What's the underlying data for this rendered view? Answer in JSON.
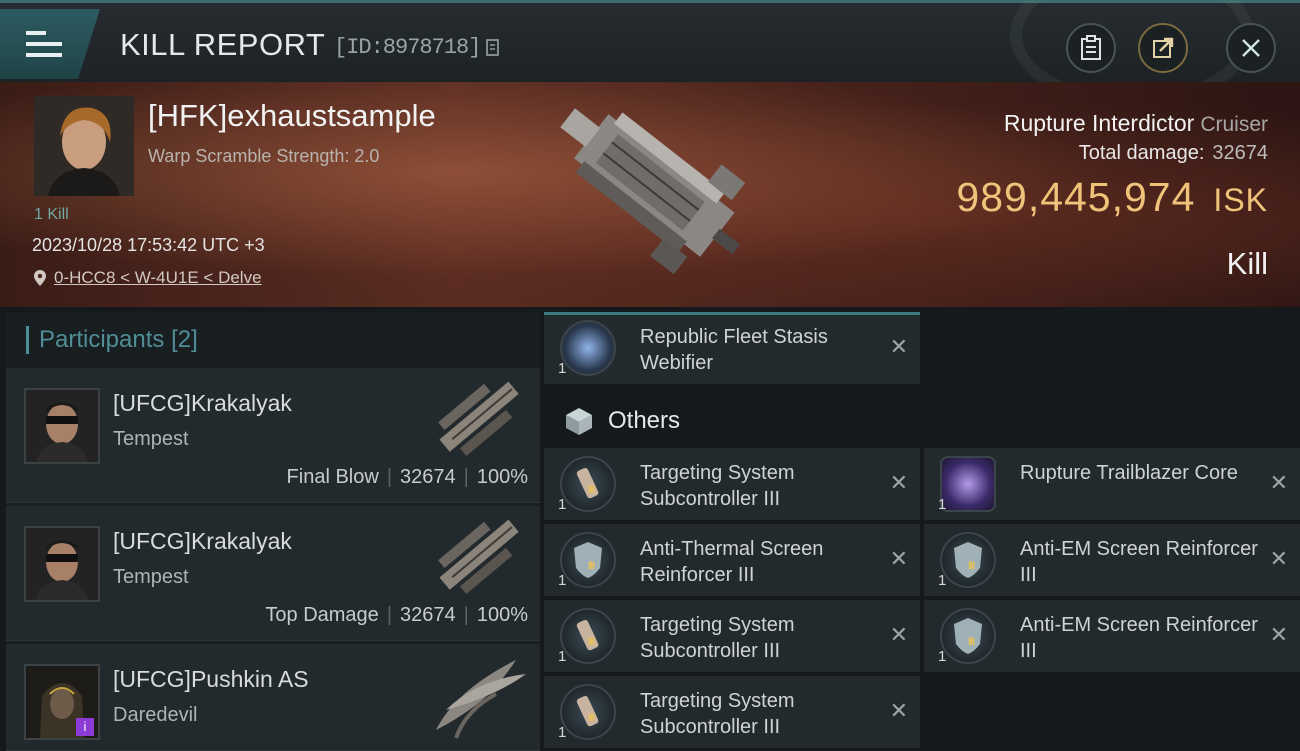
{
  "header": {
    "title": "KILL REPORT",
    "report_id": "[ID:8978718]"
  },
  "victim": {
    "name": "[HFK]exhaustsample",
    "subtitle": "Warp Scramble Strength: 2.0",
    "kill_tag": "1 Kill",
    "datetime": "2023/10/28 17:53:42 UTC +3",
    "location": "0-HCC8 < W-4U1E < Delve"
  },
  "ship": {
    "name": "Rupture Interdictor",
    "class": "Cruiser",
    "damage_label": "Total damage:",
    "damage_value": "32674",
    "isk_value": "989,445,974",
    "isk_unit": "ISK",
    "result": "Kill"
  },
  "participants": {
    "title": "Participants",
    "count": "[2]",
    "list": [
      {
        "name": "[UFCG]Krakalyak",
        "ship": "Tempest",
        "role": "Final Blow",
        "damage": "32674",
        "percent": "100%"
      },
      {
        "name": "[UFCG]Krakalyak",
        "ship": "Tempest",
        "role": "Top Damage",
        "damage": "32674",
        "percent": "100%"
      },
      {
        "name": "[UFCG]Pushkin AS",
        "ship": "Daredevil"
      }
    ]
  },
  "items": {
    "top_item": {
      "qty": "1",
      "name": "Republic Fleet Stasis Webifier"
    },
    "others_title": "Others",
    "others": [
      {
        "qty": "1",
        "name": "Targeting System Subcontroller III",
        "tier": "III"
      },
      {
        "qty": "1",
        "name": "Rupture Trailblazer Core"
      },
      {
        "qty": "1",
        "name": "Anti-Thermal Screen Reinforcer III",
        "tier": "III"
      },
      {
        "qty": "1",
        "name": "Anti-EM Screen Reinforcer III",
        "tier": "III"
      },
      {
        "qty": "1",
        "name": "Targeting System Subcontroller III",
        "tier": "III"
      },
      {
        "qty": "1",
        "name": "Anti-EM Screen Reinforcer III",
        "tier": "III"
      },
      {
        "qty": "1",
        "name": "Targeting System Subcontroller III",
        "tier": "III"
      }
    ],
    "remove_symbol": "✕"
  },
  "colors": {
    "accent": "#3d7a80",
    "isk": "#efc47a",
    "banner": "#4a231c"
  }
}
